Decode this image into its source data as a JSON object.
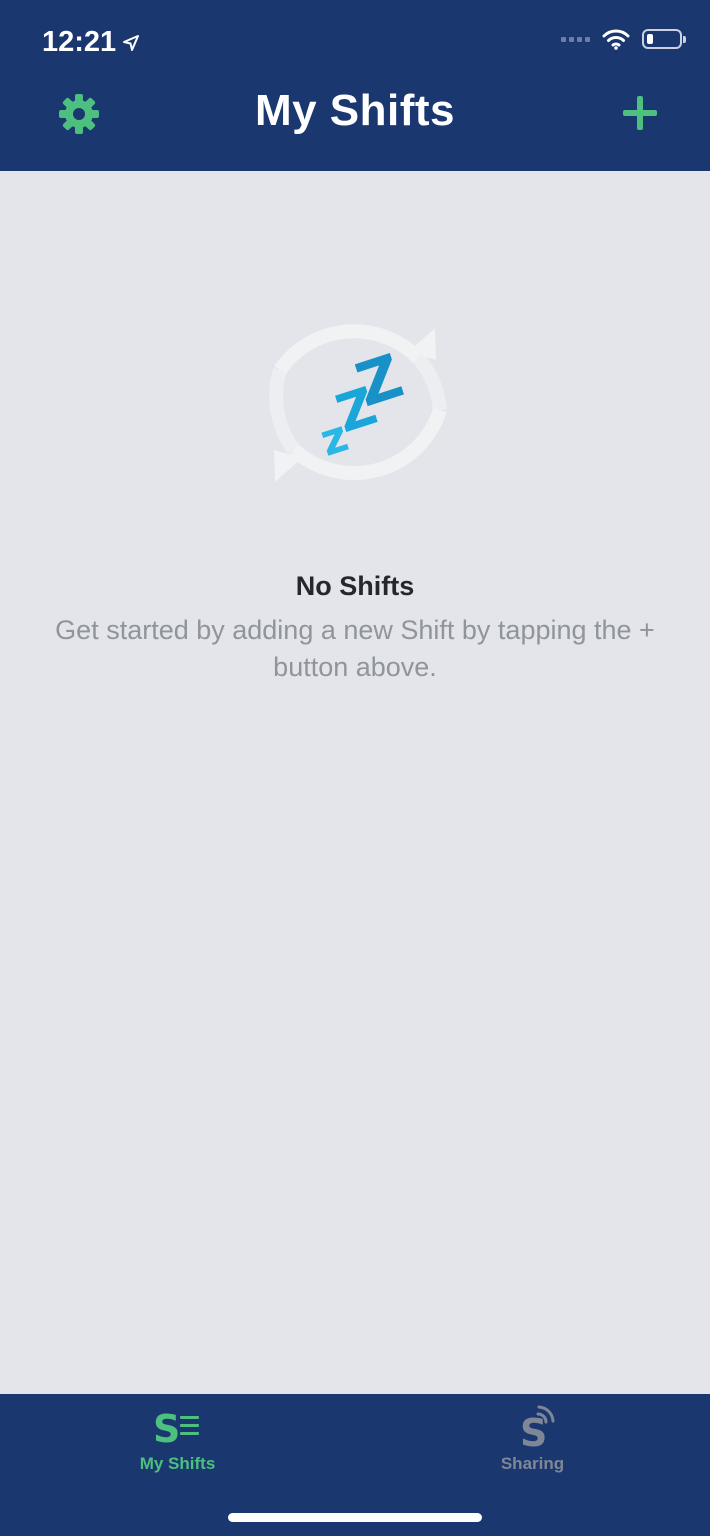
{
  "status_bar": {
    "time": "12:21"
  },
  "header": {
    "title": "My Shifts",
    "left_icon": "gear-icon",
    "right_icon": "plus-icon"
  },
  "empty_state": {
    "icon": "sleeping-zzz-icon",
    "title": "No Shifts",
    "message": "Get started by adding a new Shift by tapping the + button above."
  },
  "tabbar": {
    "tabs": [
      {
        "label": "My Shifts",
        "icon": "shifts-list-icon",
        "active": true
      },
      {
        "label": "Sharing",
        "icon": "sharing-icon",
        "active": false
      }
    ]
  },
  "colors": {
    "navy": "#1a3770",
    "accent_green": "#4dbf7e",
    "background": "#e4e5ea",
    "inactive_tab": "#7f8797"
  }
}
